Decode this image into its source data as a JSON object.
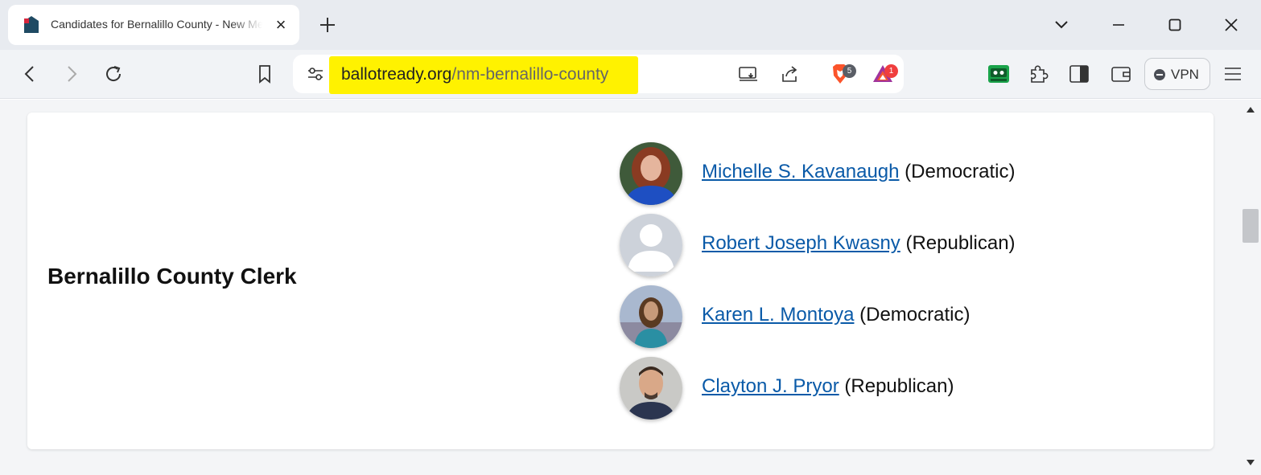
{
  "tab": {
    "title": "Candidates for Bernalillo County - New Mexico",
    "close_symbol": "×"
  },
  "toolbar": {
    "url_domain": "ballotready.org",
    "url_path": "/nm-bernalillo-county",
    "shields_badge": "5",
    "rewards_badge": "1",
    "vpn_label": "VPN"
  },
  "office": {
    "title": "Bernalillo County Clerk",
    "candidates": [
      {
        "name": "Michelle S. Kavanaugh",
        "party": "(Democratic)"
      },
      {
        "name": "Robert Joseph Kwasny",
        "party": "(Republican)"
      },
      {
        "name": "Karen L. Montoya",
        "party": "(Democratic)"
      },
      {
        "name": "Clayton J. Pryor",
        "party": "(Republican)"
      }
    ]
  },
  "icons": {
    "tab": [
      "favicon-icon",
      "close-icon",
      "plus-icon"
    ],
    "window": [
      "chevron-down-icon",
      "minimize-icon",
      "maximize-icon",
      "close-icon"
    ],
    "nav": [
      "back-icon",
      "forward-icon",
      "reload-icon",
      "bookmark-icon",
      "site-settings-icon",
      "cast-icon",
      "share-icon",
      "brave-shields-icon",
      "brave-rewards-icon",
      "wallet-extension-icon",
      "extensions-icon",
      "sidebar-icon",
      "wallet-icon",
      "menu-icon"
    ]
  },
  "colors": {
    "link": "#0a5aa8",
    "url_highlight": "#fff200",
    "shields_orange": "#fb542b",
    "rewards_red": "#f03e3e"
  }
}
